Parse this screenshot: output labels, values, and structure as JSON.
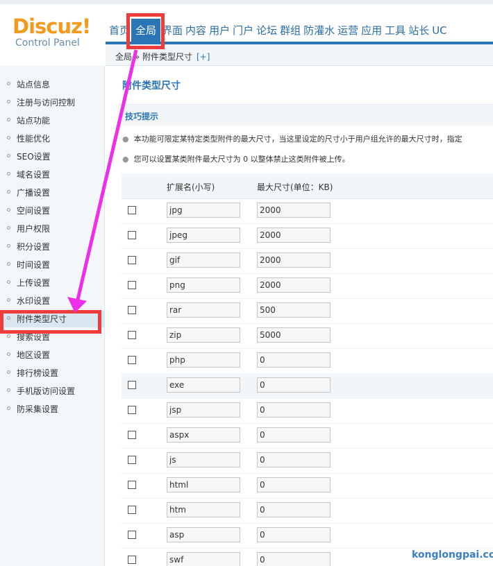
{
  "logo": {
    "brand": "Discuz!",
    "subtitle": "Control Panel"
  },
  "nav": [
    "首页",
    "全局",
    "界面",
    "内容",
    "用户",
    "门户",
    "论坛",
    "群组",
    "防灌水",
    "运营",
    "应用",
    "工具",
    "站长",
    "UC"
  ],
  "breadcrumb": {
    "text": "全局 » 附件类型尺寸",
    "plus": "[+]"
  },
  "sidebar": [
    "站点信息",
    "注册与访问控制",
    "站点功能",
    "性能优化",
    "SEO设置",
    "域名设置",
    "广播设置",
    "空间设置",
    "用户权限",
    "积分设置",
    "时间设置",
    "上传设置",
    "水印设置",
    "附件类型尺寸",
    "搜索设置",
    "地区设置",
    "排行榜设置",
    "手机版访问设置",
    "防采集设置"
  ],
  "page_title": "附件类型尺寸",
  "tips": {
    "title": "技巧提示",
    "items": [
      "本功能可限定某特定类型附件的最大尺寸，当这里设定的尺寸小于用户组允许的最大尺寸时，指定",
      "您可以设置某类附件最大尺寸为 0 以整体禁止这类附件被上传。"
    ]
  },
  "table": {
    "headers": [
      "扩展名(小写)",
      "最大尺寸(单位：KB)"
    ],
    "rows": [
      {
        "ext": "jpg",
        "size": "2000"
      },
      {
        "ext": "jpeg",
        "size": "2000"
      },
      {
        "ext": "gif",
        "size": "2000"
      },
      {
        "ext": "png",
        "size": "2000"
      },
      {
        "ext": "rar",
        "size": "500"
      },
      {
        "ext": "zip",
        "size": "5000"
      },
      {
        "ext": "php",
        "size": "0"
      },
      {
        "ext": "exe",
        "size": "0"
      },
      {
        "ext": "jsp",
        "size": "0"
      },
      {
        "ext": "aspx",
        "size": "0"
      },
      {
        "ext": "js",
        "size": "0"
      },
      {
        "ext": "html",
        "size": "0"
      },
      {
        "ext": "htm",
        "size": "0"
      },
      {
        "ext": "asp",
        "size": "0"
      },
      {
        "ext": "swf",
        "size": "0"
      }
    ]
  },
  "watermark": "konglongpai.com",
  "colors": {
    "accent": "#2a75b6",
    "highlight": "#ee3b3b",
    "arrow": "#ee2ee8",
    "logo_orange": "#f29b1f"
  }
}
